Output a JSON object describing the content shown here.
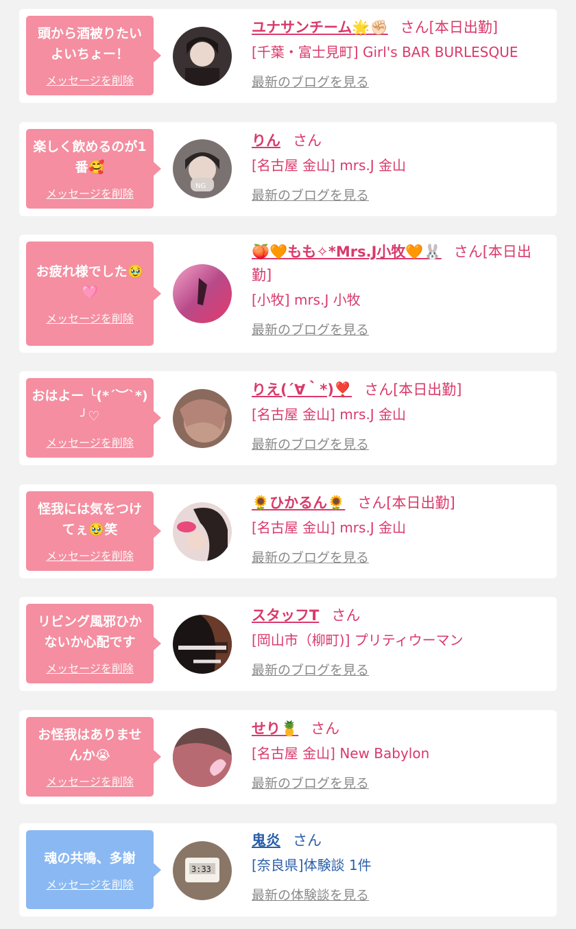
{
  "delete_label": "メッセージを削除",
  "colors": {
    "pink": "#f48ea0",
    "blue": "#8ab8f2",
    "name_pink": "#d9396b",
    "name_blue": "#2a5ea8",
    "link_gray": "#8a8a8a"
  },
  "cards": [
    {
      "message": "頭から酒被りたいよいちょー！",
      "name": "ユナサンチーム🌟✊🏻",
      "suffix": "さん[本日出勤]",
      "shop": "[千葉・富士見町] Girl's BAR BURLESQUE",
      "link": "最新のブログを見る"
    },
    {
      "message": "楽しく飲めるのが1番🥰",
      "name": "りん",
      "suffix": "さん",
      "shop": "[名古屋 金山] mrs.J 金山",
      "link": "最新のブログを見る"
    },
    {
      "message": "お疲れ様でした🥹🩷",
      "name": "🍑🧡もも✧*Mrs.J小牧🧡🐰",
      "suffix": "さん[本日出勤]",
      "shop": "[小牧] mrs.J 小牧",
      "link": "最新のブログを見る"
    },
    {
      "message": "おはよー ╰(*´︶`*)╯♡",
      "name": "りえ(´∀｀*)❣️",
      "suffix": "さん[本日出勤]",
      "shop": "[名古屋 金山] mrs.J 金山",
      "link": "最新のブログを見る"
    },
    {
      "message": "怪我には気をつけてぇ🥹笑",
      "name": "🌻ひかるん🌻",
      "suffix": "さん[本日出勤]",
      "shop": "[名古屋 金山] mrs.J 金山",
      "link": "最新のブログを見る"
    },
    {
      "message": "リビング風邪ひかないか心配です",
      "name": "スタッフT",
      "suffix": "さん",
      "shop": "[岡山市（柳町)] プリティウーマン",
      "link": "最新のブログを見る"
    },
    {
      "message": "お怪我はありませんか😭",
      "name": "せり🍍",
      "suffix": "さん",
      "shop": "[名古屋 金山] New Babylon",
      "link": "最新のブログを見る"
    },
    {
      "message": "魂の共鳴、多謝",
      "name": "鬼炎",
      "suffix": "さん",
      "shop": "[奈良県]体験談 1件",
      "link": "最新の体験談を見る"
    }
  ]
}
